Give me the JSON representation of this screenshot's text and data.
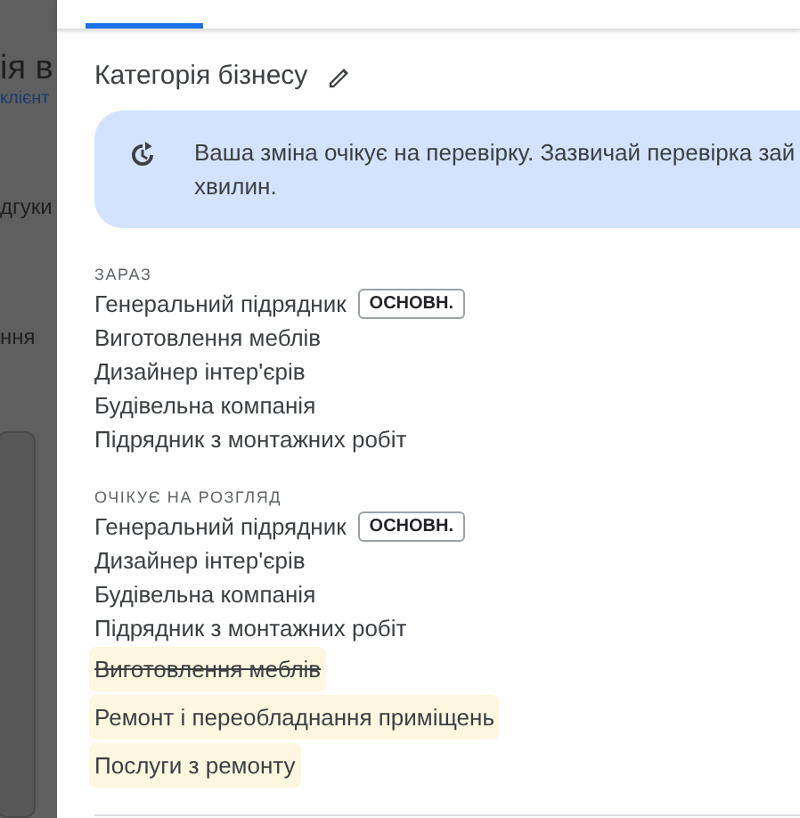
{
  "background": {
    "title_fragment": "ія в",
    "link_fragment": "клієнт",
    "item_fragments": [
      "дгуки",
      "ння"
    ]
  },
  "panel": {
    "title": "Категорія бізнесу",
    "notice": {
      "lines": [
        "Ваша зміна очікує на перевірку. Зазвичай перевірка зай",
        "хвилин."
      ]
    },
    "sections": [
      {
        "heading": "ЗАРАЗ",
        "items": [
          {
            "label": "Генеральний підрядник",
            "badge": "ОСНОВН.",
            "kind": "current"
          },
          {
            "label": "Виготовлення меблів",
            "kind": "current"
          },
          {
            "label": "Дизайнер інтер'єрів",
            "kind": "current"
          },
          {
            "label": "Будівельна компанія",
            "kind": "current"
          },
          {
            "label": "Підрядник з монтажних робіт",
            "kind": "current"
          }
        ]
      },
      {
        "heading": "ОЧІКУЄ НА РОЗГЛЯД",
        "items": [
          {
            "label": "Генеральний підрядник",
            "badge": "ОСНОВН.",
            "kind": "current"
          },
          {
            "label": "Дизайнер інтер'єрів",
            "kind": "current"
          },
          {
            "label": "Будівельна компанія",
            "kind": "current"
          },
          {
            "label": "Підрядник з монтажних робіт",
            "kind": "current"
          },
          {
            "label": "Виготовлення меблів",
            "kind": "removed"
          },
          {
            "label": "Ремонт і переобладнання приміщень",
            "kind": "added"
          },
          {
            "label": "Послуги з ремонту",
            "kind": "added"
          }
        ]
      }
    ]
  }
}
